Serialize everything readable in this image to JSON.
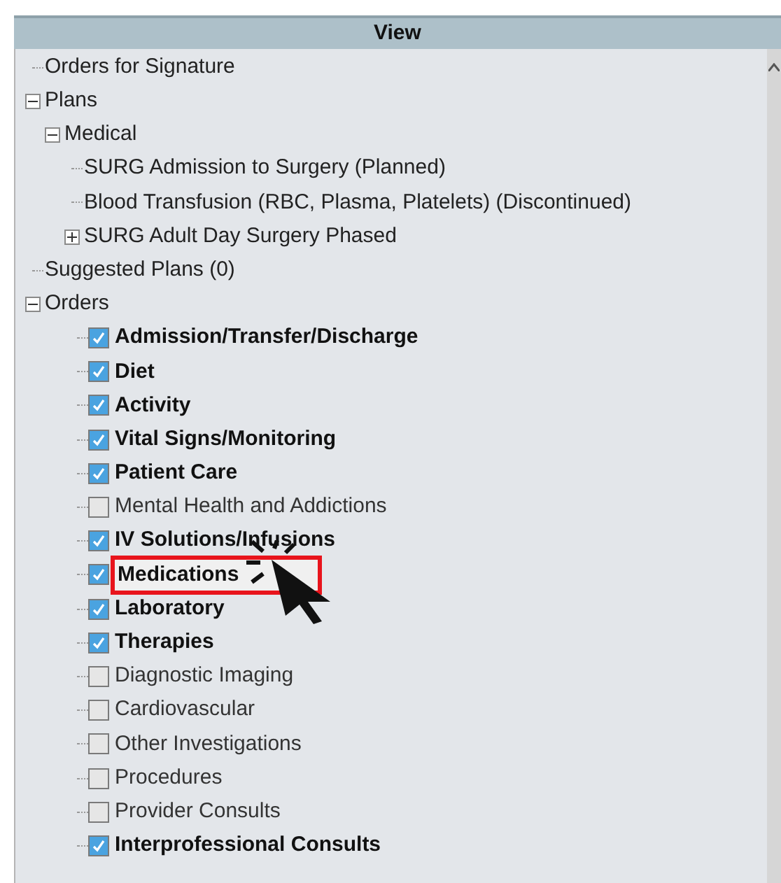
{
  "header": {
    "title": "View"
  },
  "tree": [
    {
      "label": "Orders for Signature"
    },
    {
      "label": "Plans",
      "expanded": true,
      "children": [
        {
          "label": "Medical",
          "expanded": true,
          "children": [
            {
              "label": "SURG Admission to Surgery (Planned)"
            },
            {
              "label": "Blood Transfusion (RBC, Plasma, Platelets) (Discontinued)"
            },
            {
              "label": "SURG Adult Day Surgery Phased",
              "expanded": false
            }
          ]
        }
      ]
    },
    {
      "label": "Suggested Plans (0)"
    },
    {
      "label": "Orders",
      "expanded": true,
      "children": [
        {
          "kind": "checkbox",
          "label": "Admission/Transfer/Discharge",
          "checked": true,
          "highlighted": false
        },
        {
          "kind": "checkbox",
          "label": "Diet",
          "checked": true,
          "highlighted": false
        },
        {
          "kind": "checkbox",
          "label": "Activity",
          "checked": true,
          "highlighted": false
        },
        {
          "kind": "checkbox",
          "label": "Vital Signs/Monitoring",
          "checked": true,
          "highlighted": false
        },
        {
          "kind": "checkbox",
          "label": "Patient Care",
          "checked": true,
          "highlighted": false
        },
        {
          "kind": "checkbox",
          "label": "Mental Health and Addictions",
          "checked": false,
          "highlighted": false
        },
        {
          "kind": "checkbox",
          "label": "IV Solutions/Infusions",
          "checked": true,
          "highlighted": false
        },
        {
          "kind": "checkbox",
          "label": "Medications",
          "checked": true,
          "highlighted": true
        },
        {
          "kind": "checkbox",
          "label": "Laboratory",
          "checked": true,
          "highlighted": false
        },
        {
          "kind": "checkbox",
          "label": "Therapies",
          "checked": true,
          "highlighted": false
        },
        {
          "kind": "checkbox",
          "label": "Diagnostic Imaging",
          "checked": false,
          "highlighted": false
        },
        {
          "kind": "checkbox",
          "label": "Cardiovascular",
          "checked": false,
          "highlighted": false
        },
        {
          "kind": "checkbox",
          "label": "Other Investigations",
          "checked": false,
          "highlighted": false
        },
        {
          "kind": "checkbox",
          "label": "Procedures",
          "checked": false,
          "highlighted": false
        },
        {
          "kind": "checkbox",
          "label": "Provider Consults",
          "checked": false,
          "highlighted": false
        },
        {
          "kind": "checkbox",
          "label": "Interprofessional Consults",
          "checked": true,
          "highlighted": false
        }
      ]
    }
  ]
}
